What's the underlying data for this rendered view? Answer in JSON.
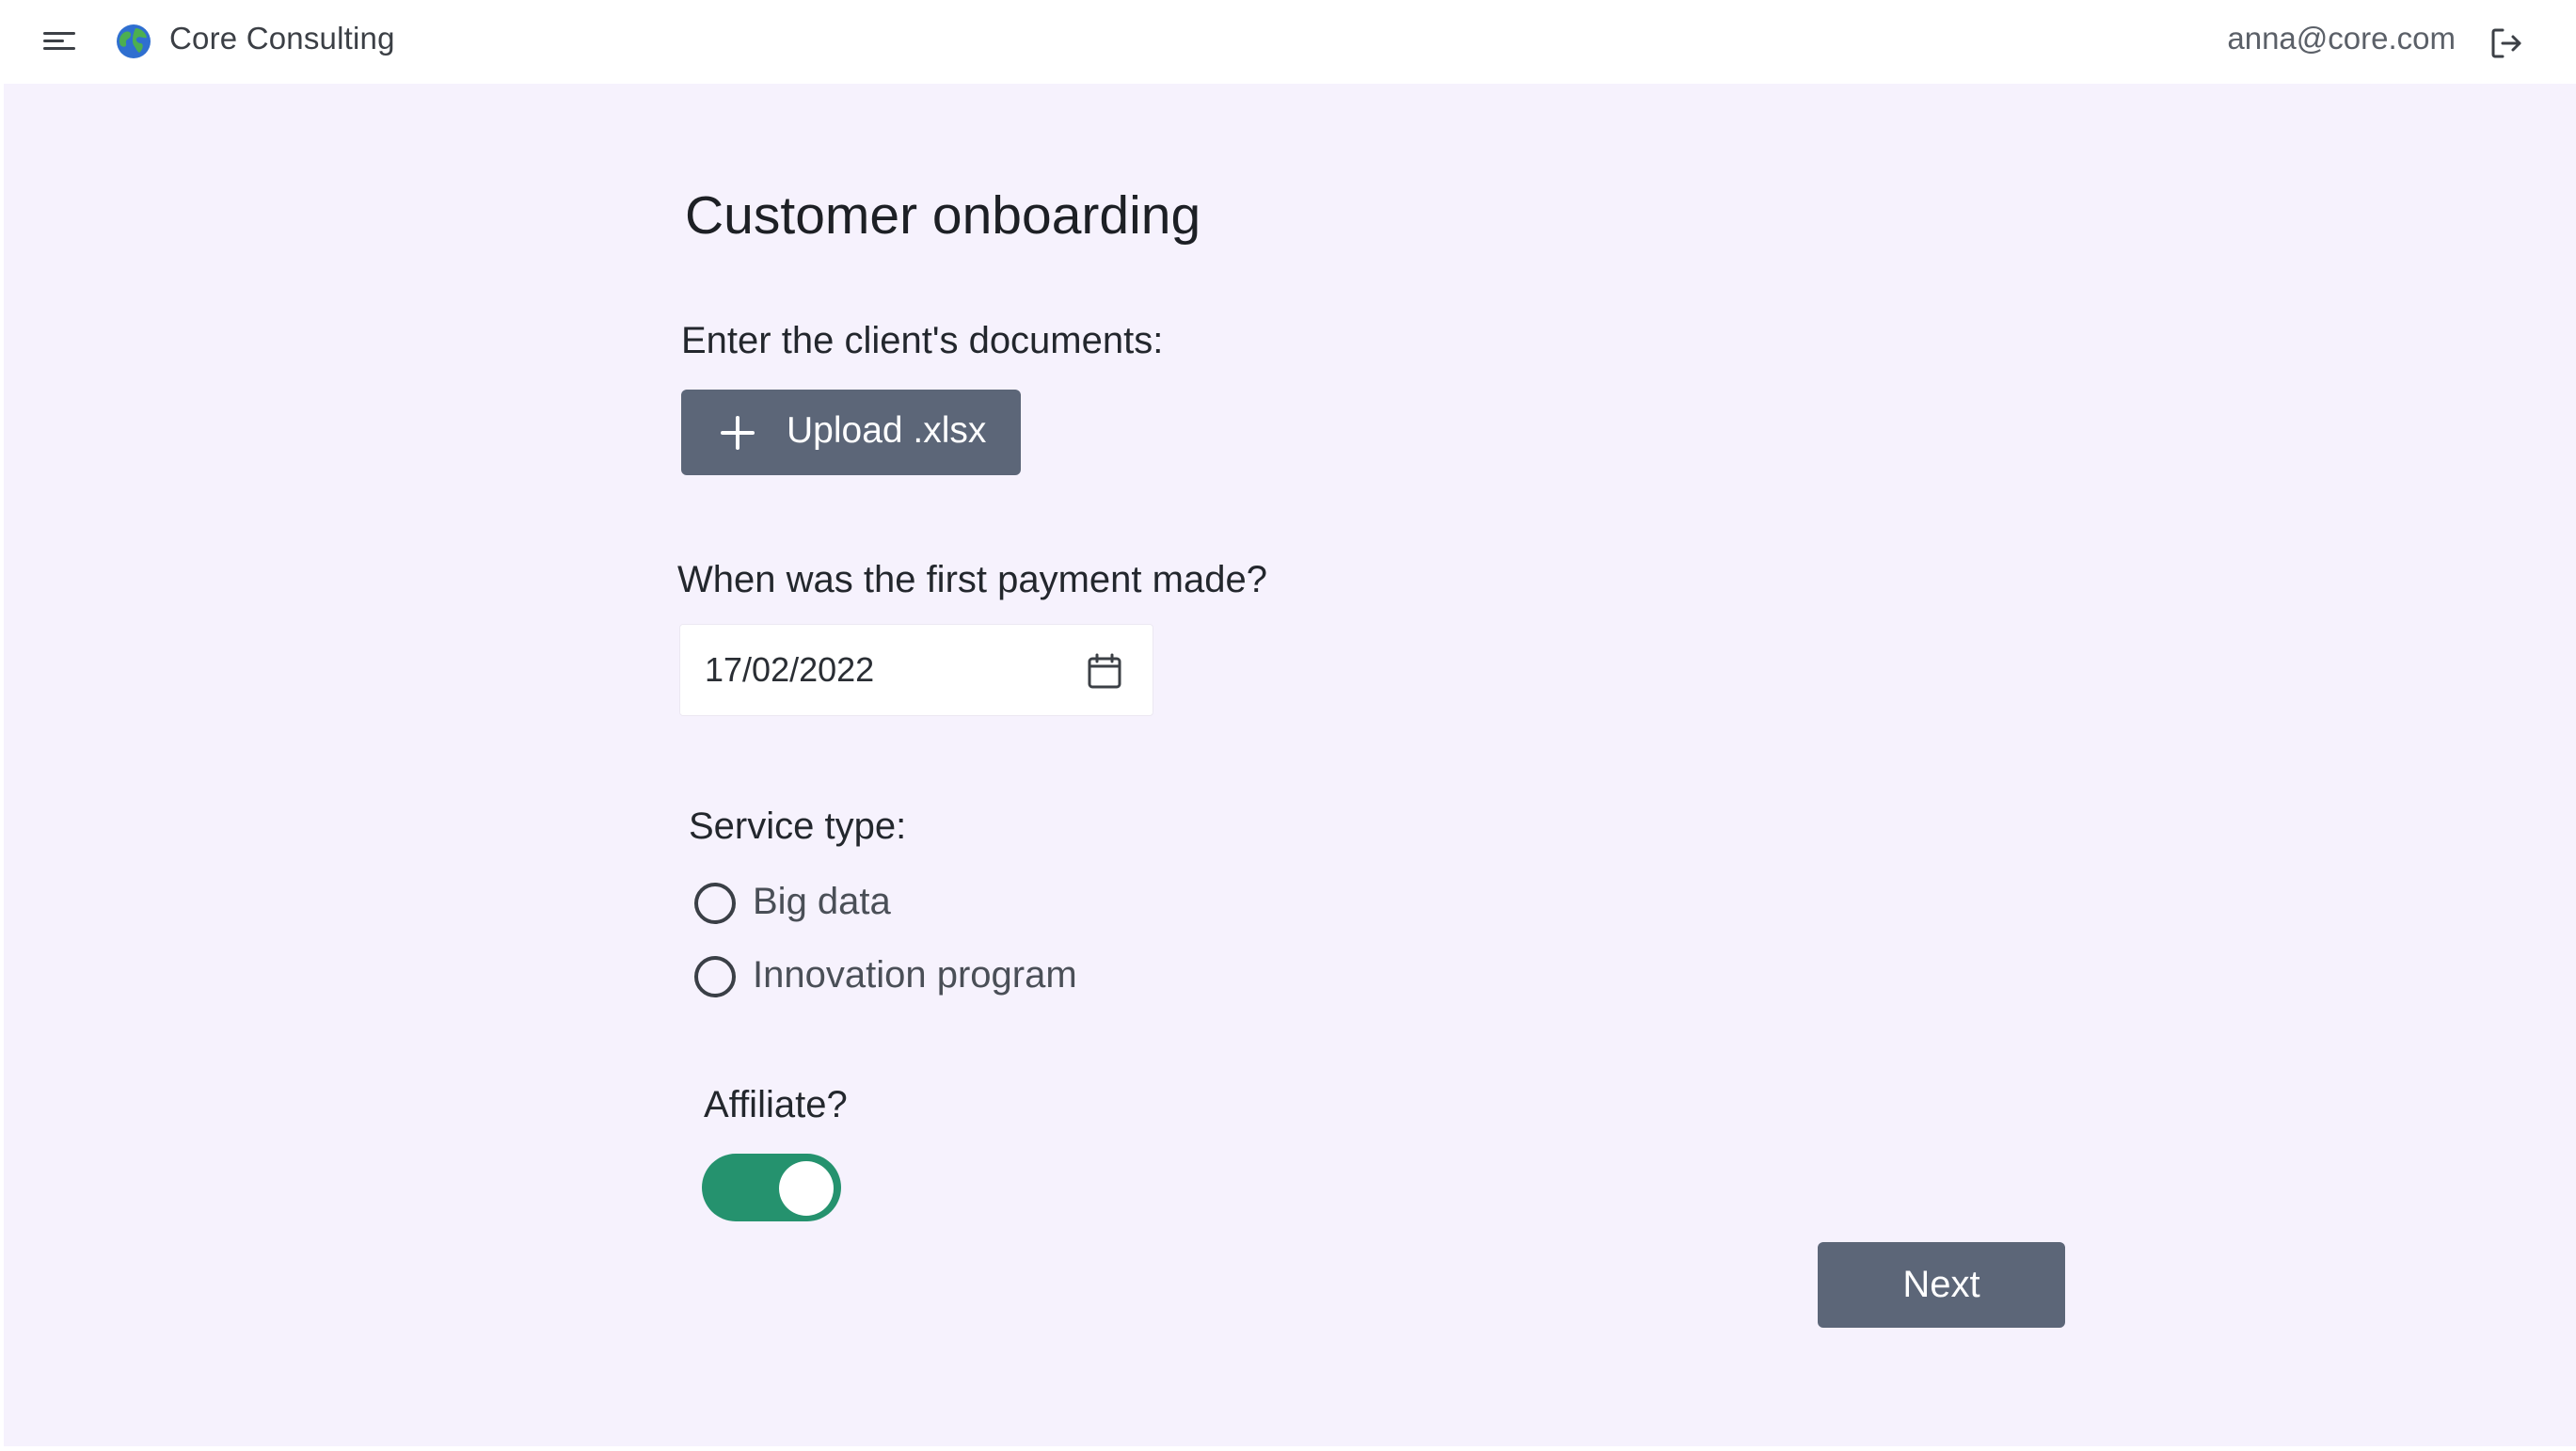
{
  "header": {
    "brand_name": "Core Consulting",
    "user_email": "anna@core.com",
    "menu_icon": "hamburger-menu-icon",
    "logo_icon": "globe-icon",
    "logout_icon": "logout-icon"
  },
  "form": {
    "title": "Customer onboarding",
    "documents_label": "Enter the client's documents:",
    "upload_button_label": "Upload .xlsx",
    "payment_label": "When was the first payment made?",
    "payment_date": "17/02/2022",
    "service_label": "Service type:",
    "service_options": [
      {
        "label": "Big data",
        "selected": false
      },
      {
        "label": "Innovation program",
        "selected": false
      }
    ],
    "affiliate_label": "Affiliate?",
    "affiliate_on": true,
    "next_button_label": "Next"
  },
  "colors": {
    "page_background": "#f6f2fd",
    "button_background": "#5c6678",
    "toggle_on": "#25926e"
  }
}
